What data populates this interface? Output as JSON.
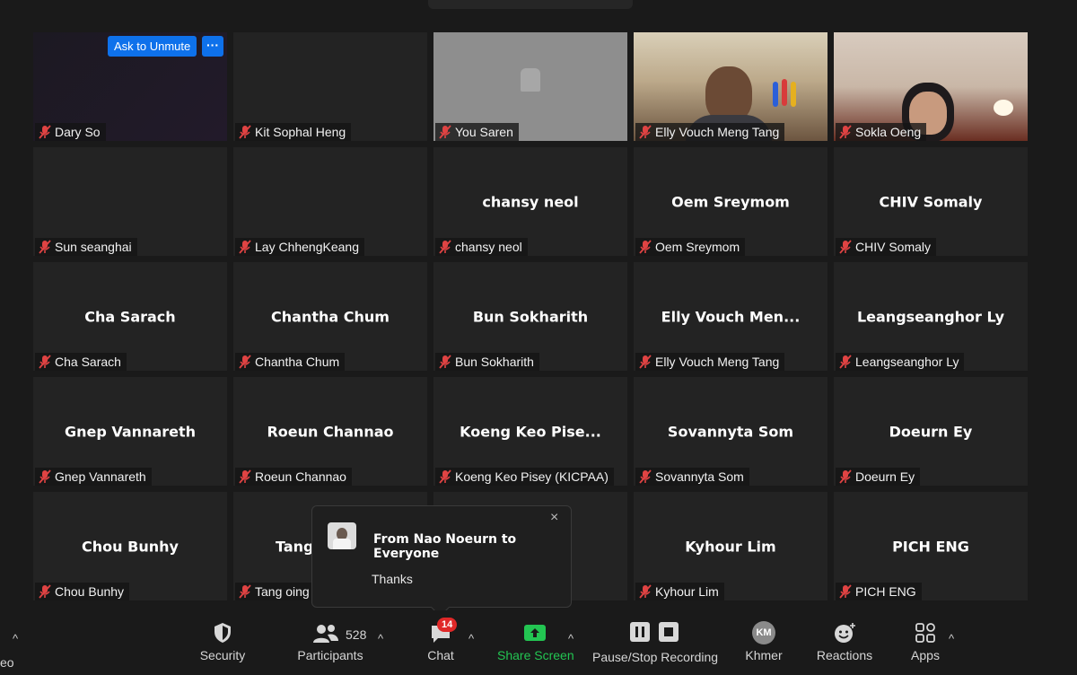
{
  "tiles": [
    {
      "plate": "Dary So",
      "big": ""
    },
    {
      "plate": "Kit Sophal Heng",
      "big": ""
    },
    {
      "plate": "You Saren",
      "big": ""
    },
    {
      "plate": "Elly Vouch Meng Tang",
      "big": ""
    },
    {
      "plate": "Sokla Oeng",
      "big": ""
    },
    {
      "plate": "Sun seanghai",
      "big": ""
    },
    {
      "plate": "Lay ChhengKeang",
      "big": ""
    },
    {
      "plate": "chansy neol",
      "big": "chansy neol"
    },
    {
      "plate": "Oem Sreymom",
      "big": "Oem Sreymom"
    },
    {
      "plate": "CHIV Somaly",
      "big": "CHIV Somaly"
    },
    {
      "plate": "Cha Sarach",
      "big": "Cha Sarach"
    },
    {
      "plate": "Chantha Chum",
      "big": "Chantha Chum"
    },
    {
      "plate": "Bun Sokharith",
      "big": "Bun Sokharith"
    },
    {
      "plate": "Elly Vouch Meng Tang",
      "big": "Elly  Vouch  Men..."
    },
    {
      "plate": "Leangseanghor Ly",
      "big": "Leangseanghor Ly"
    },
    {
      "plate": "Gnep Vannareth",
      "big": "Gnep Vannareth"
    },
    {
      "plate": "Roeun Channao",
      "big": "Roeun Channao"
    },
    {
      "plate": "Koeng Keo Pisey (KICPAA)",
      "big": "Koeng  Keo  Pise..."
    },
    {
      "plate": "Sovannyta Som",
      "big": "Sovannyta Som"
    },
    {
      "plate": "Doeurn Ey",
      "big": "Doeurn Ey"
    },
    {
      "plate": "Chou Bunhy",
      "big": "Chou Bunhy"
    },
    {
      "plate": "Tang oing",
      "big": "Tang"
    },
    {
      "plate": "",
      "big": ""
    },
    {
      "plate": "Kyhour Lim",
      "big": "Kyhour Lim"
    },
    {
      "plate": "PICH ENG",
      "big": "PICH ENG"
    }
  ],
  "overlay": {
    "ask_to_unmute": "Ask to Unmute",
    "more": "···"
  },
  "chat_popup": {
    "from": "From Nao Noeurn to Everyone",
    "message": "Thanks",
    "close": "×"
  },
  "toolbar": {
    "video_partial": "eo",
    "security": "Security",
    "participants": "Participants",
    "participants_count": "528",
    "chat": "Chat",
    "chat_badge": "14",
    "share_screen": "Share Screen",
    "recording": "Pause/Stop Recording",
    "language_initials": "KM",
    "language": "Khmer",
    "reactions": "Reactions",
    "apps": "Apps"
  },
  "colors": {
    "accent": "#0e71eb",
    "share": "#23c552",
    "badge": "#e02828",
    "muted": "#e04343"
  }
}
